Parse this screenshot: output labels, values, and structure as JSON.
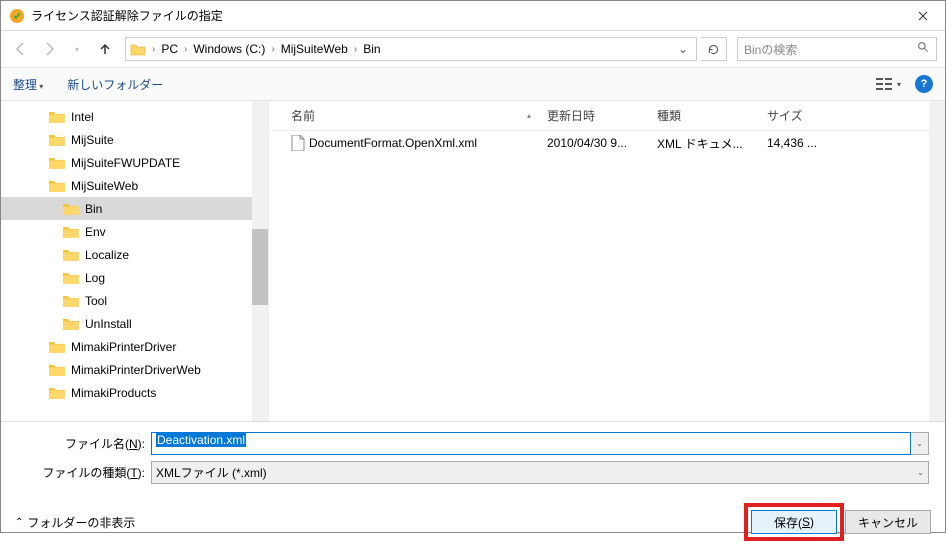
{
  "window": {
    "title": "ライセンス認証解除ファイルの指定"
  },
  "nav": {
    "breadcrumb": [
      "PC",
      "Windows (C:)",
      "MijSuiteWeb",
      "Bin"
    ],
    "search_placeholder": "Binの検索"
  },
  "toolbar": {
    "organize": "整理",
    "new_folder": "新しいフォルダー"
  },
  "tree": {
    "items": [
      {
        "name": "Intel",
        "indent": 0,
        "sel": false
      },
      {
        "name": "MijSuite",
        "indent": 0,
        "sel": false
      },
      {
        "name": "MijSuiteFWUPDATE",
        "indent": 0,
        "sel": false
      },
      {
        "name": "MijSuiteWeb",
        "indent": 0,
        "sel": false
      },
      {
        "name": "Bin",
        "indent": 1,
        "sel": true
      },
      {
        "name": "Env",
        "indent": 1,
        "sel": false
      },
      {
        "name": "Localize",
        "indent": 1,
        "sel": false
      },
      {
        "name": "Log",
        "indent": 1,
        "sel": false
      },
      {
        "name": "Tool",
        "indent": 1,
        "sel": false
      },
      {
        "name": "UnInstall",
        "indent": 1,
        "sel": false
      },
      {
        "name": "MimakiPrinterDriver",
        "indent": 0,
        "sel": false
      },
      {
        "name": "MimakiPrinterDriverWeb",
        "indent": 0,
        "sel": false
      },
      {
        "name": "MimakiProducts",
        "indent": 0,
        "sel": false
      }
    ]
  },
  "list": {
    "headers": {
      "name": "名前",
      "date": "更新日時",
      "type": "種類",
      "size": "サイズ"
    },
    "rows": [
      {
        "name": "DocumentFormat.OpenXml.xml",
        "date": "2010/04/30 9...",
        "type": "XML ドキュメ...",
        "size": "14,436 ..."
      }
    ]
  },
  "form": {
    "filename_label": "ファイル名(N):",
    "filename_value": "Deactivation.xml",
    "filetype_label": "ファイルの種類(T):",
    "filetype_value": "XMLファイル (*.xml)"
  },
  "footer": {
    "hide_folders": "フォルダーの非表示",
    "save": "保存(S)",
    "cancel": "キャンセル"
  }
}
